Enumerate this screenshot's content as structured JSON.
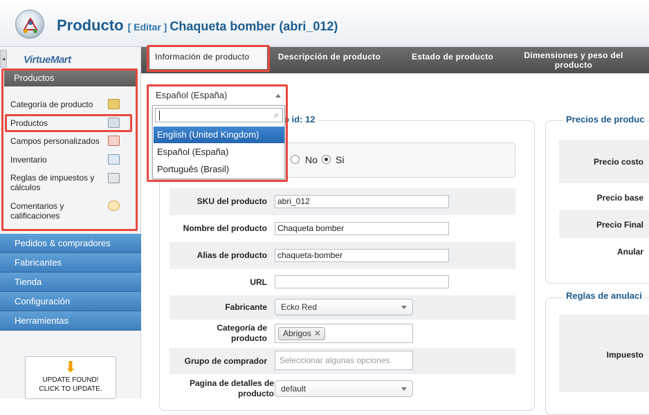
{
  "header": {
    "title_main": "Producto",
    "title_action": "[ Editar ]",
    "title_product": "Chaqueta bomber (abri_012)"
  },
  "sidebar": {
    "logo_text": "VirtueMart",
    "section_title": "Productos",
    "items": [
      {
        "label": "Categoría de producto",
        "icon": "category-icon"
      },
      {
        "label": "Productos",
        "icon": "products-icon"
      },
      {
        "label": "Campos personalizados",
        "icon": "custom-fields-icon"
      },
      {
        "label": "Inventario",
        "icon": "inventory-icon"
      },
      {
        "label": "Reglas de impuestos y cálculos",
        "icon": "calculator-icon"
      },
      {
        "label": "Comentarios y calificaciones",
        "icon": "comments-icon"
      }
    ],
    "nav": [
      {
        "label": "Pedidos & compradores"
      },
      {
        "label": "Fabricantes"
      },
      {
        "label": "Tienda"
      },
      {
        "label": "Configuración"
      },
      {
        "label": "Herramientas"
      }
    ],
    "update_line1": "UPDATE FOUND!",
    "update_line2": "CLICK TO UPDATE."
  },
  "tabs": [
    {
      "label": "Información de producto",
      "active": true
    },
    {
      "label": "Descripción de producto",
      "active": false
    },
    {
      "label": "Estado de producto",
      "active": false
    },
    {
      "label": "Dimensiones y peso del producto",
      "active": false
    }
  ],
  "language": {
    "selected": "Español (España)",
    "search_value": "",
    "options": [
      {
        "label": "English (United Kingdom)",
        "highlighted": true
      },
      {
        "label": "Español (España)",
        "highlighted": false
      },
      {
        "label": "Português (Brasil)",
        "highlighted": false
      }
    ]
  },
  "product_panel": {
    "legend_suffix": "o id: 12",
    "published_no": "No",
    "published_si": "Si",
    "published_value": "Si",
    "fields": {
      "sku_label": "SKU del producto",
      "sku_value": "abri_012",
      "name_label": "Nombre del producto",
      "name_value": "Chaqueta bomber",
      "alias_label": "Alias de producto",
      "alias_value": "chaqueta-bomber",
      "url_label": "URL",
      "url_value": "",
      "manufacturer_label": "Fabricante",
      "manufacturer_value": "Ecko Red",
      "category_label": "Categoría de producto",
      "category_value": "Abrigos",
      "shopper_group_label": "Grupo de comprador",
      "shopper_group_placeholder": "Seleccionar algunas opciones",
      "details_page_label": "Pagina de detalles de producto",
      "details_page_value": "default"
    }
  },
  "prices_panel": {
    "legend": "Precios de produc",
    "cost_label": "Precio costo",
    "base_label": "Precio base",
    "final_label": "Precio Final",
    "override_label": "Anular"
  },
  "override_panel": {
    "legend": "Reglas de anulaci",
    "tax_label": "Impuesto"
  },
  "colors": {
    "highlight": "#e8493f",
    "nav_blue": "#3f80bf",
    "title_blue": "#1d5c8f"
  }
}
